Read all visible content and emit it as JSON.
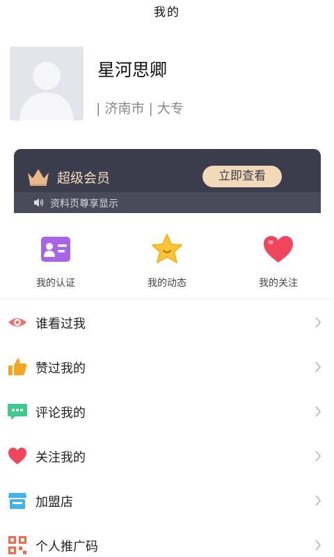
{
  "header": {
    "title": "我的"
  },
  "profile": {
    "name": "星河思卿",
    "meta": "| 济南市 | 大专"
  },
  "vip": {
    "title": "超级会员",
    "button": "立即查看",
    "subtitle": "资料页尊享显示"
  },
  "quick_actions": [
    {
      "label": "我的认证",
      "icon": "id-card-icon"
    },
    {
      "label": "我的动态",
      "icon": "star-icon"
    },
    {
      "label": "我的关注",
      "icon": "heart-icon"
    }
  ],
  "menu": [
    {
      "label": "谁看过我",
      "icon": "eye-icon"
    },
    {
      "label": "赞过我的",
      "icon": "thumbs-up-icon"
    },
    {
      "label": "评论我的",
      "icon": "chat-bubble-icon"
    },
    {
      "label": "关注我的",
      "icon": "heart-icon"
    },
    {
      "label": "加盟店",
      "icon": "shop-icon"
    },
    {
      "label": "个人推广码",
      "icon": "qr-code-icon"
    }
  ],
  "colors": {
    "vip_bg": "#3c3d4c",
    "vip_gold": "#f1d9b9",
    "id_card": "#a865e8",
    "star": "#ffc533",
    "heart": "#f0455c",
    "eye": "#ef6f6a",
    "chat": "#3ec98f",
    "shop": "#3fb2f0",
    "qr": "#f36a4b"
  }
}
